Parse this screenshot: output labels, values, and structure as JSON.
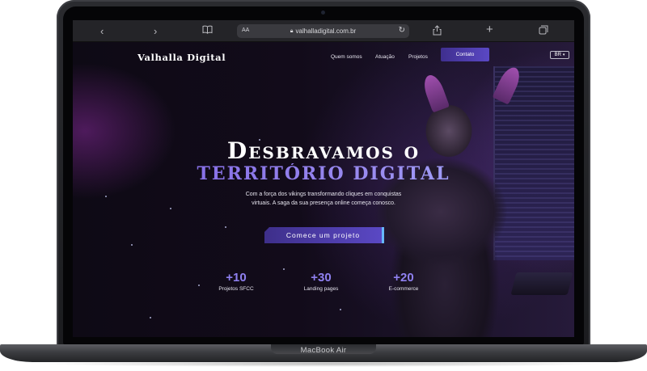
{
  "device": {
    "model_label": "MacBook Air"
  },
  "browser": {
    "url": "valhalladigital.com.br",
    "reader_label": "AA",
    "icons": [
      "back-icon",
      "forward-icon",
      "bookmarks-icon",
      "lock-icon",
      "reload-icon",
      "share-icon",
      "new-tab-icon",
      "tabs-icon"
    ]
  },
  "nav": {
    "logo": "Valhalla Digital",
    "links": [
      "Quem somos",
      "Atuação",
      "Projetos"
    ],
    "contact_label": "Contato",
    "language": "BR"
  },
  "hero": {
    "title_line1": "Desbravamos o",
    "title_line2": "TERRITÓRIO DIGITAL",
    "subtitle_line1": "Com a força dos vikings transformando cliques em conquistas",
    "subtitle_line2": "virtuais. A saga da sua presença online começa conosco.",
    "cta_label": "Comece um projeto"
  },
  "stats": [
    {
      "value": "+10",
      "label": "Projetos SFCC"
    },
    {
      "value": "+30",
      "label": "Landing pages"
    },
    {
      "value": "+20",
      "label": "E-commerce"
    }
  ],
  "colors": {
    "accent": "#5a48c4",
    "stat_number": "#8f80f0",
    "title_gradient_end": "#a8b6ff"
  }
}
